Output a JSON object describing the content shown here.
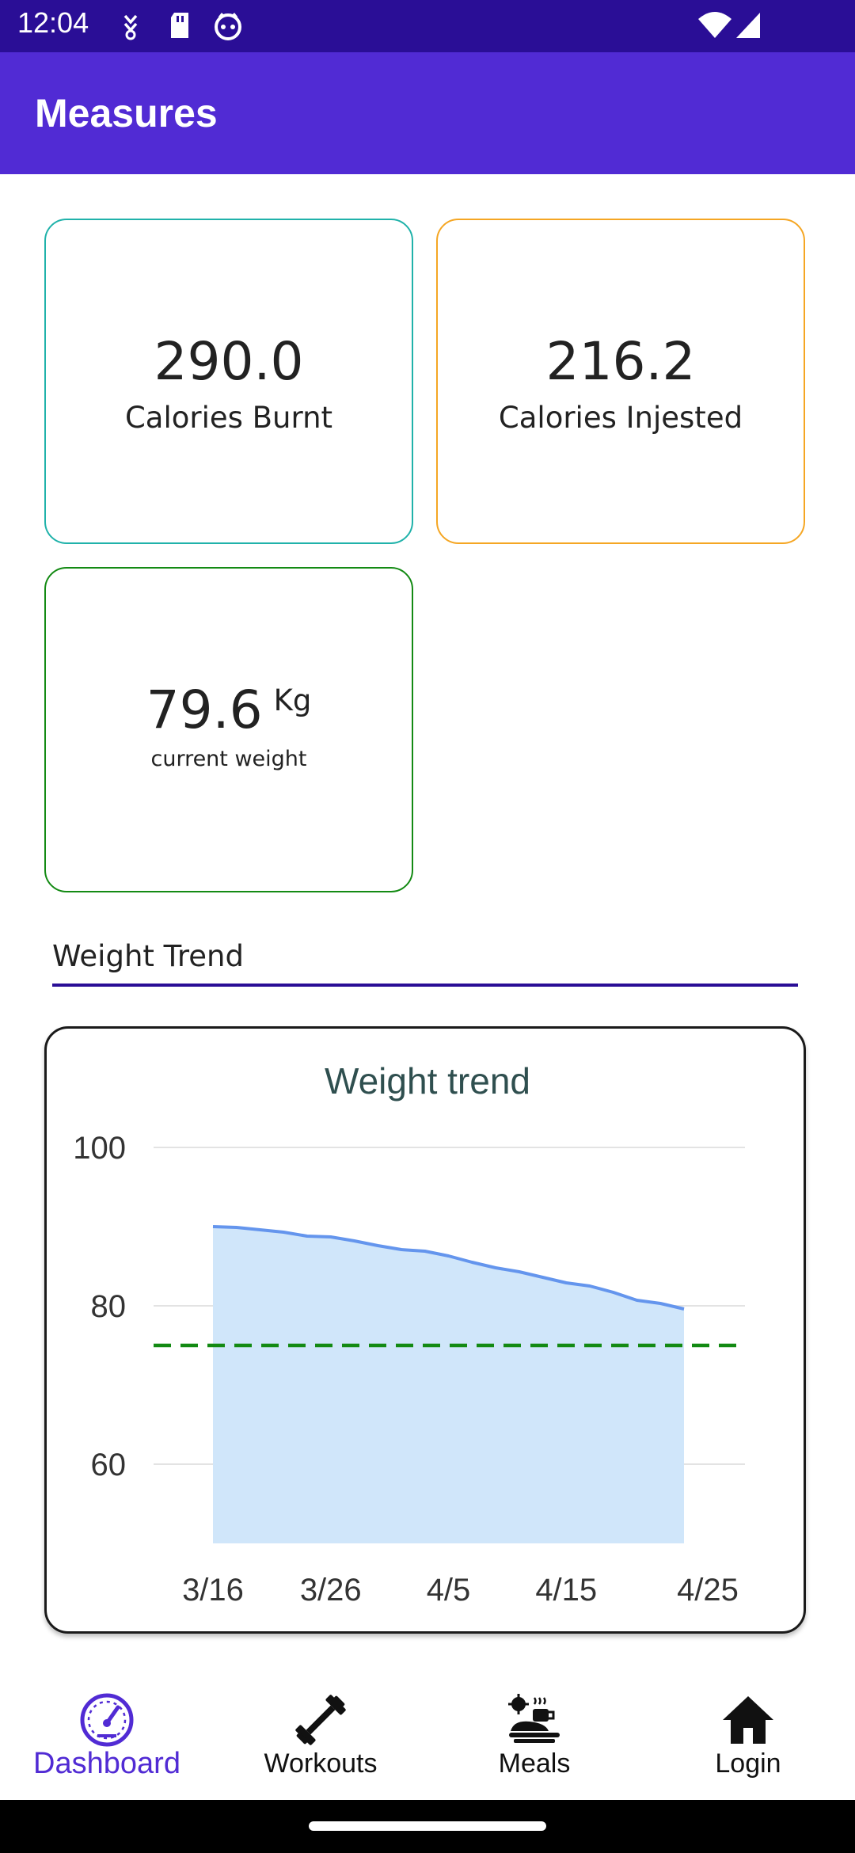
{
  "status_bar": {
    "time": "12:04"
  },
  "app_bar": {
    "title": "Measures"
  },
  "cards": {
    "burnt": {
      "value": "290.0",
      "label": "Calories Burnt"
    },
    "ingested": {
      "value": "216.2",
      "label": "Calories Injested"
    },
    "weight": {
      "value": "79.6",
      "unit": "Kg",
      "label": "current weight"
    }
  },
  "section": {
    "title": "Weight Trend"
  },
  "chart_data": {
    "type": "area",
    "title": "Weight trend",
    "xlabel": "",
    "ylabel": "",
    "x_ticks": [
      "3/16",
      "3/26",
      "4/5",
      "4/15",
      "4/25"
    ],
    "y_ticks": [
      100,
      80,
      60
    ],
    "ylim": [
      50,
      100
    ],
    "grid": true,
    "x": [
      "3/16",
      "3/18",
      "3/20",
      "3/22",
      "3/24",
      "3/26",
      "3/28",
      "3/30",
      "4/1",
      "4/3",
      "4/5",
      "4/7",
      "4/9",
      "4/11",
      "4/13",
      "4/15",
      "4/17",
      "4/19",
      "4/21",
      "4/23",
      "4/25"
    ],
    "series": [
      {
        "values": [
          90.0,
          89.9,
          89.6,
          89.3,
          88.8,
          88.7,
          88.2,
          87.6,
          87.1,
          86.9,
          86.3,
          85.5,
          84.8,
          84.3,
          83.6,
          82.9,
          82.5,
          81.7,
          80.7,
          80.3,
          79.6
        ]
      }
    ],
    "reference_line": {
      "value": 75,
      "style": "dashed"
    },
    "colors": {
      "line": "#6495ed",
      "fill": "#d0e6fa",
      "reference": "#138a13",
      "title": "#2f4f4f"
    }
  },
  "nav": {
    "items": [
      {
        "label": "Dashboard",
        "icon": "dashboard-gauge-icon",
        "active": true
      },
      {
        "label": "Workouts",
        "icon": "dumbbell-icon",
        "active": false
      },
      {
        "label": "Meals",
        "icon": "meal-icon",
        "active": false
      },
      {
        "label": "Login",
        "icon": "home-icon",
        "active": false
      }
    ]
  },
  "colors": {
    "status_bar": "#2a0e96",
    "app_bar": "#512bd4",
    "accent": "#512bd4",
    "burnt_border": "#20b2aa",
    "ingested_border": "#f5a623",
    "weight_border": "#138a13"
  }
}
